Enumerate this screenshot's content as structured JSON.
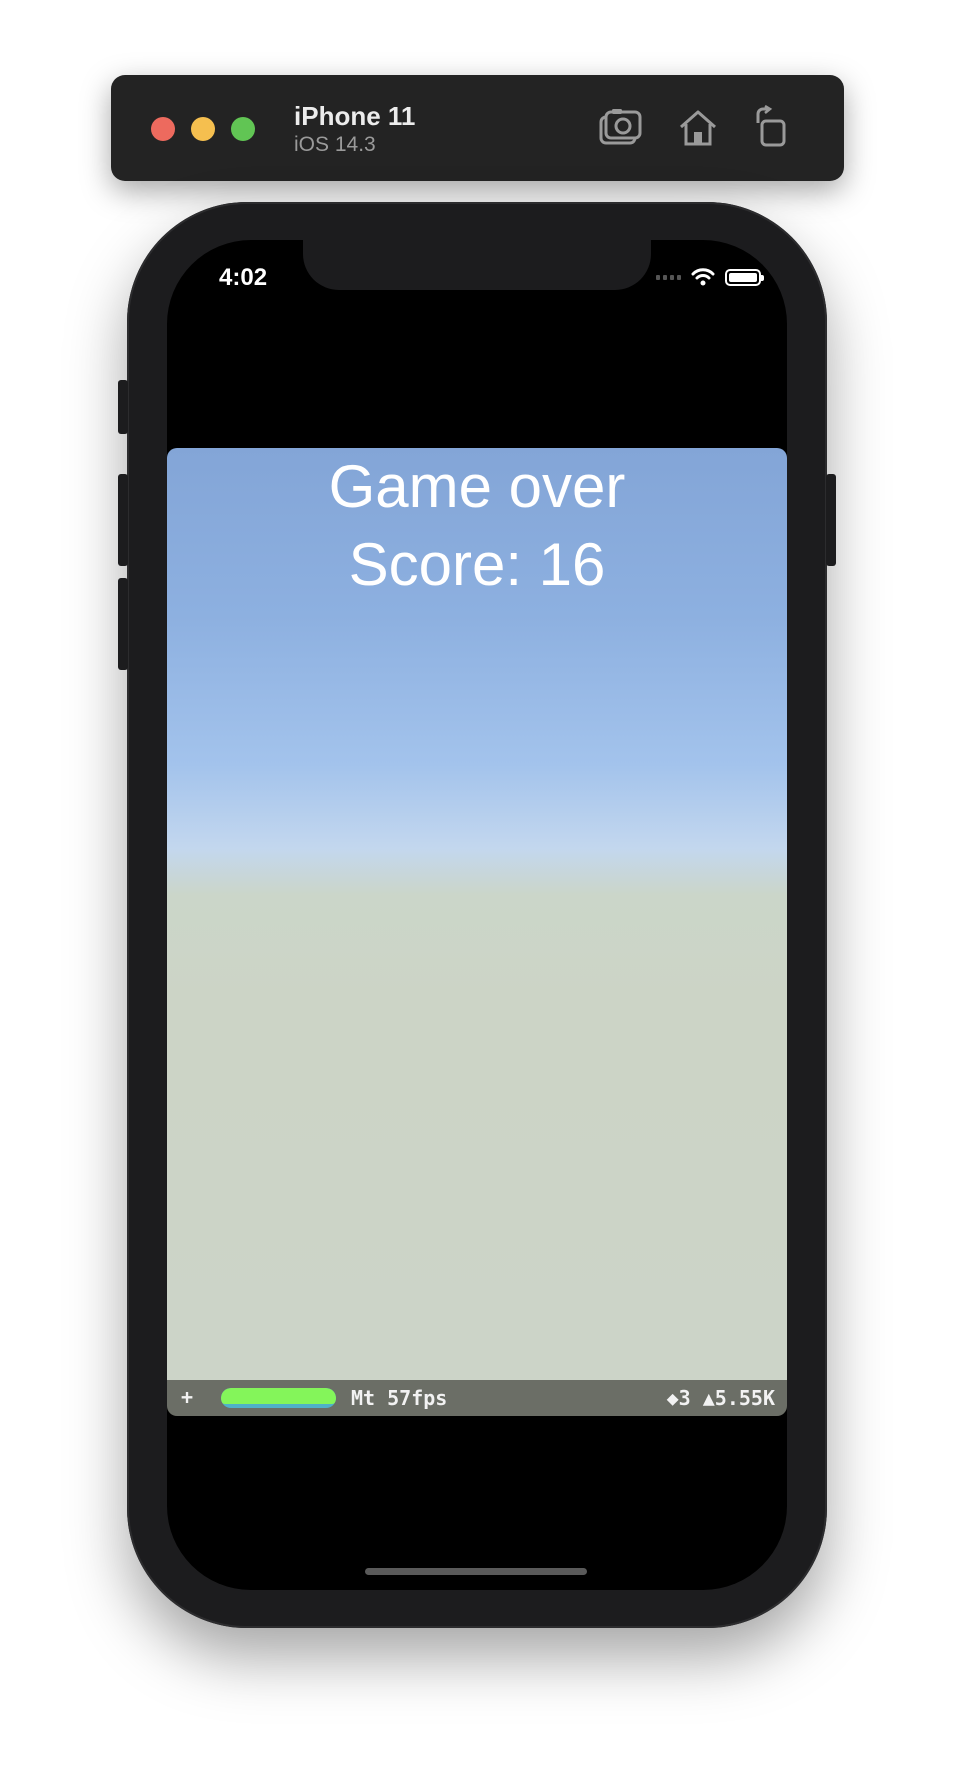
{
  "simulator": {
    "device_name": "iPhone 11",
    "os_version": "iOS 14.3",
    "buttons": [
      "screenshot-icon",
      "home-icon",
      "rotate-icon"
    ]
  },
  "status_bar": {
    "time": "4:02"
  },
  "game": {
    "title": "Game over",
    "score_text": "Score: 16"
  },
  "hud": {
    "plus": "+",
    "fps_label": "Mt 57fps",
    "stats": "◆3 ▲5.55K",
    "bar_fill_fraction": 1.0,
    "bar_color": "#84f55a"
  },
  "colors": {
    "sky_top": "#83a5d7",
    "ground": "#ccd4c6",
    "hud_bg": "#6b6e66"
  }
}
